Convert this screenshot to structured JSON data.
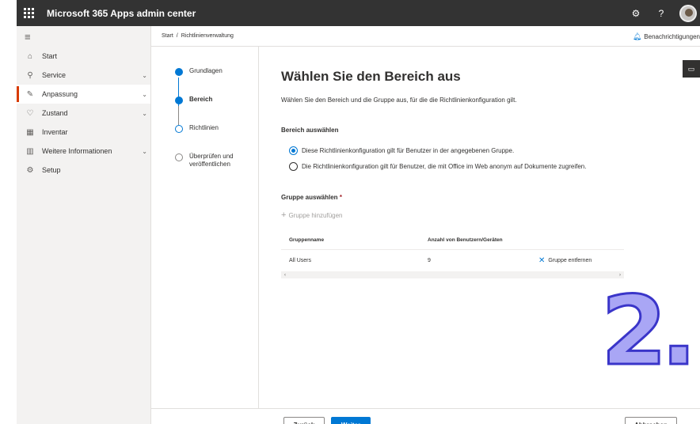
{
  "app": {
    "title": "Microsoft 365 Apps admin center"
  },
  "topbar": {
    "settings_icon": "gear-icon",
    "help_label": "?"
  },
  "sidebar": {
    "items": [
      {
        "label": "Start",
        "icon": "home-icon",
        "expandable": false
      },
      {
        "label": "Service",
        "icon": "service-icon",
        "expandable": true
      },
      {
        "label": "Anpassung",
        "icon": "customize-icon",
        "expandable": true,
        "active": true
      },
      {
        "label": "Zustand",
        "icon": "health-icon",
        "expandable": true
      },
      {
        "label": "Inventar",
        "icon": "inventory-icon",
        "expandable": false
      },
      {
        "label": "Weitere Informationen",
        "icon": "book-icon",
        "expandable": true
      },
      {
        "label": "Setup",
        "icon": "setup-icon",
        "expandable": false
      }
    ]
  },
  "breadcrumb": {
    "home": "Start",
    "separator": "/",
    "current": "Richtlinienverwaltung"
  },
  "notifications": {
    "label": "Benachrichtigungen"
  },
  "stepper": {
    "steps": [
      {
        "label": "Grundlagen",
        "state": "done"
      },
      {
        "label": "Bereich",
        "state": "current"
      },
      {
        "label": "Richtlinien",
        "state": "next"
      },
      {
        "label": "Überprüfen und veröffentlichen",
        "state": "todo"
      }
    ]
  },
  "main": {
    "title": "Wählen Sie den Bereich aus",
    "description": "Wählen Sie den Bereich und die Gruppe aus, für die die Richtlinienkonfiguration gilt.",
    "scope_label": "Bereich auswählen",
    "scope_options": [
      {
        "label": "Diese Richtlinienkonfiguration gilt für Benutzer in der angegebenen Gruppe.",
        "checked": true
      },
      {
        "label": "Die Richtlinienkonfiguration gilt für Benutzer, die mit Office im Web anonym auf Dokumente zugreifen.",
        "checked": false
      }
    ],
    "group_label": "Gruppe auswählen",
    "required_marker": "*",
    "add_group_label": "Gruppe hinzufügen",
    "table": {
      "headers": [
        "Gruppenname",
        "Anzahl von Benutzern/Geräten"
      ],
      "rows": [
        {
          "name": "All Users",
          "count": "9",
          "action": "Gruppe entfernen"
        }
      ]
    }
  },
  "overlay": {
    "annotation": "2."
  },
  "footer": {
    "back_label": "Zurück",
    "next_label": "Weiter",
    "cancel_label": "Abbrechen"
  },
  "colors": {
    "accent": "#0078d4",
    "topbar": "#333333",
    "active_marker": "#d83b01",
    "annotation_fill": "#a9a6f5",
    "annotation_stroke": "#3a35c9"
  }
}
